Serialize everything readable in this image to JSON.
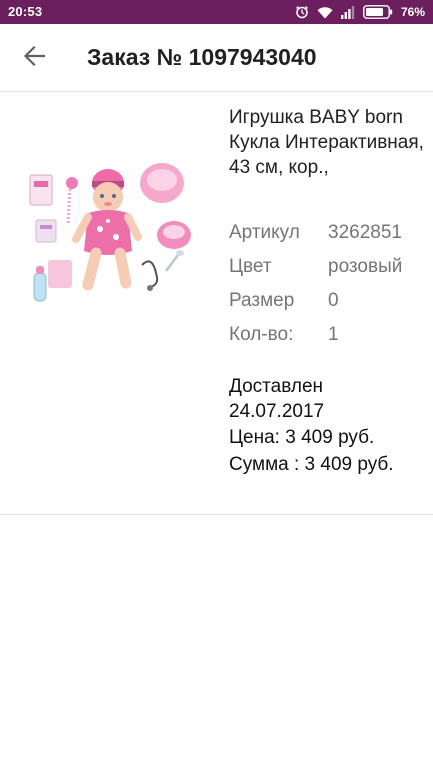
{
  "status_bar": {
    "time": "20:53",
    "battery": "76%"
  },
  "header": {
    "back_icon": "arrow-back-icon",
    "title": "Заказ № 1097943040"
  },
  "order_item": {
    "image_description": "Interactive BABY born doll set with accessories",
    "name": "Игрушка BABY born Кукла Интерактивная, 43 см, кор.,",
    "attributes": [
      {
        "label": "Артикул",
        "value": "3262851"
      },
      {
        "label": "Цвет",
        "value": "розовый"
      },
      {
        "label": "Размер",
        "value": "0"
      },
      {
        "label": "Кол-во:",
        "value": "1"
      }
    ],
    "status": "Доставлен",
    "date": "24.07.2017",
    "price": "Цена: 3 409 руб.",
    "total": "Сумма : 3 409 руб."
  },
  "colors": {
    "status_bar": "#6b1f5e",
    "text_primary": "#212121",
    "text_secondary": "#757575"
  }
}
